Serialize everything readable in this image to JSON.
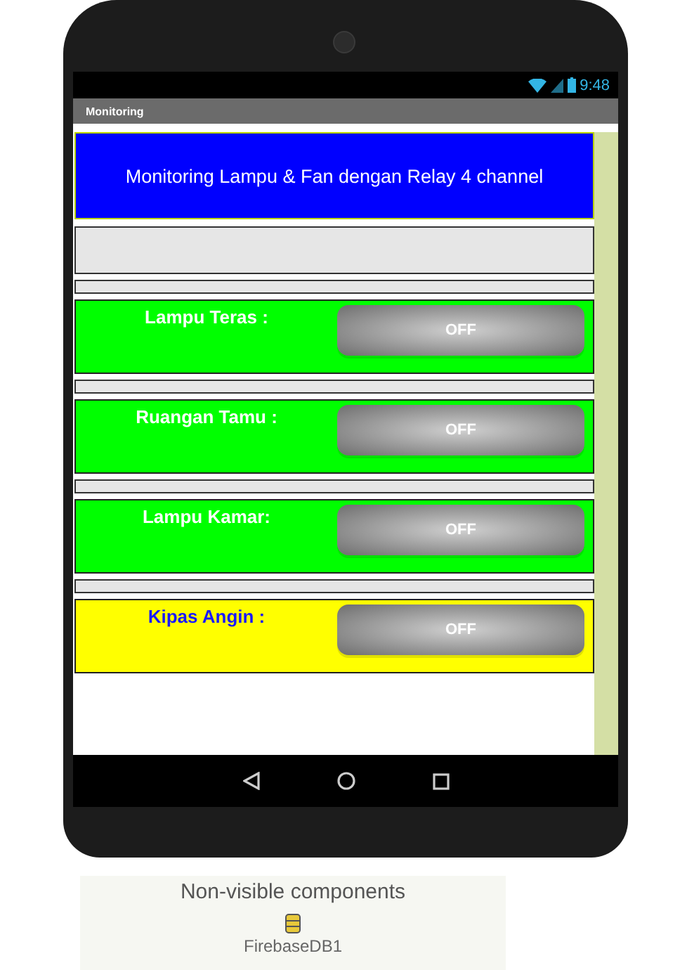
{
  "status_bar": {
    "time": "9:48"
  },
  "screen": {
    "title": "Monitoring"
  },
  "header": {
    "text": "Monitoring Lampu & Fan dengan Relay 4 channel"
  },
  "rows": [
    {
      "label": {
        "text": "Lampu Teras :",
        "color": "#ffffff"
      },
      "color": "#00ff00",
      "button": "OFF"
    },
    {
      "label": {
        "text": "Ruangan Tamu :",
        "color": "#ffffff"
      },
      "color": "#00ff00",
      "button": "OFF"
    },
    {
      "label": {
        "text": "Lampu Kamar:",
        "color": "#ffffff"
      },
      "color": "#00ff00",
      "button": "OFF"
    },
    {
      "label": {
        "text": "Kipas Angin :",
        "color": "#1a1aff"
      },
      "color": "#ffff00",
      "button": "OFF"
    }
  ],
  "non_visible": {
    "title": "Non-visible components",
    "items": [
      {
        "label": "FirebaseDB1"
      }
    ]
  }
}
